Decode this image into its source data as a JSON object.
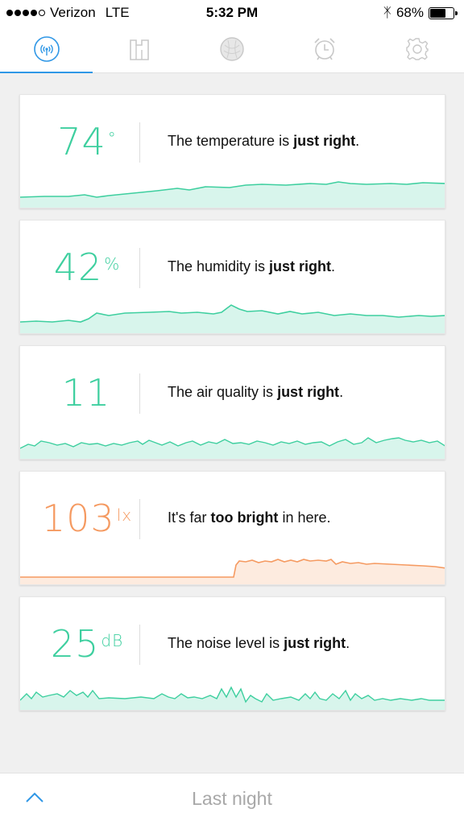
{
  "status_bar": {
    "carrier": "Verizon",
    "network": "LTE",
    "time": "5:32 PM",
    "battery": "68%",
    "battery_level": 0.68,
    "signal_bars_filled": 4
  },
  "tabs": [
    {
      "icon": "sensor-icon",
      "active": true
    },
    {
      "icon": "room-icon",
      "active": false
    },
    {
      "icon": "sleep-sphere-icon",
      "active": false
    },
    {
      "icon": "alarm-clock-icon",
      "active": false
    },
    {
      "icon": "gear-icon",
      "active": false
    }
  ],
  "cards": [
    {
      "value": "74",
      "unit": "°",
      "msg_pre": "The temperature is ",
      "msg_bold": "just right",
      "msg_post": ".",
      "color": "#3ecf9f"
    },
    {
      "value": "42",
      "unit": "%",
      "msg_pre": "The humidity is ",
      "msg_bold": "just right",
      "msg_post": ".",
      "color": "#3ecf9f"
    },
    {
      "value": "11",
      "unit": "",
      "msg_pre": "The air quality is ",
      "msg_bold": "just right",
      "msg_post": ".",
      "color": "#3ecf9f"
    },
    {
      "value": "103",
      "unit": "lx",
      "msg_pre": "It's far ",
      "msg_bold": "too bright",
      "msg_post": " in here.",
      "color": "#f59a61"
    },
    {
      "value": "25",
      "unit": "dB",
      "msg_pre": "The noise level is ",
      "msg_bold": "just right",
      "msg_post": ".",
      "color": "#3ecf9f"
    }
  ],
  "colors": {
    "accent": "#2f97e6",
    "good": "#3ecf9f",
    "bad": "#f59a61"
  },
  "bottom": {
    "label": "Last night"
  }
}
